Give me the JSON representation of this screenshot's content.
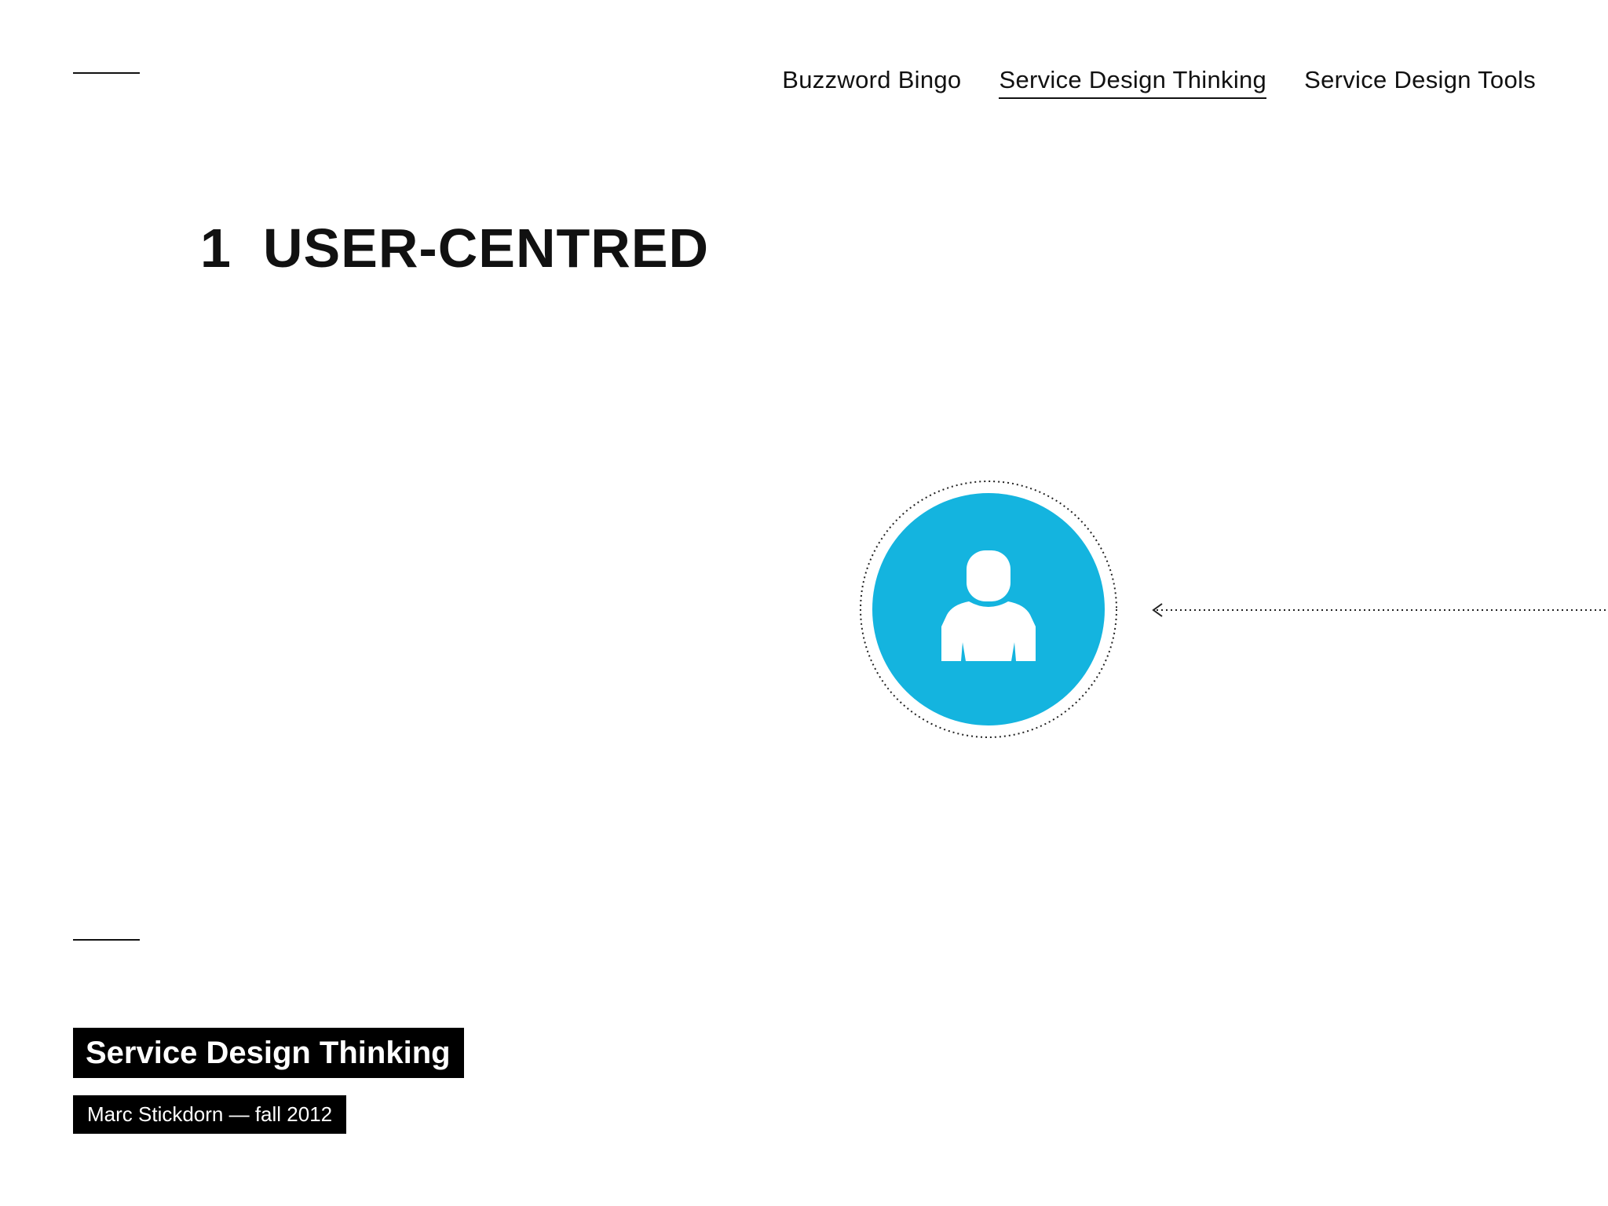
{
  "nav": {
    "items": [
      {
        "label": "Buzzword Bingo",
        "active": false
      },
      {
        "label": "Service Design Thinking",
        "active": true
      },
      {
        "label": "Service Design Tools",
        "active": false
      }
    ]
  },
  "section": {
    "number": "1",
    "title": "USER-CENTRED"
  },
  "diagram": {
    "icon": "person-icon",
    "circle_color": "#14b4df",
    "arrow_icon": "arrow-left-icon"
  },
  "footer": {
    "title": "Service Design Thinking",
    "author": "Marc Stickdorn — fall 2012"
  }
}
